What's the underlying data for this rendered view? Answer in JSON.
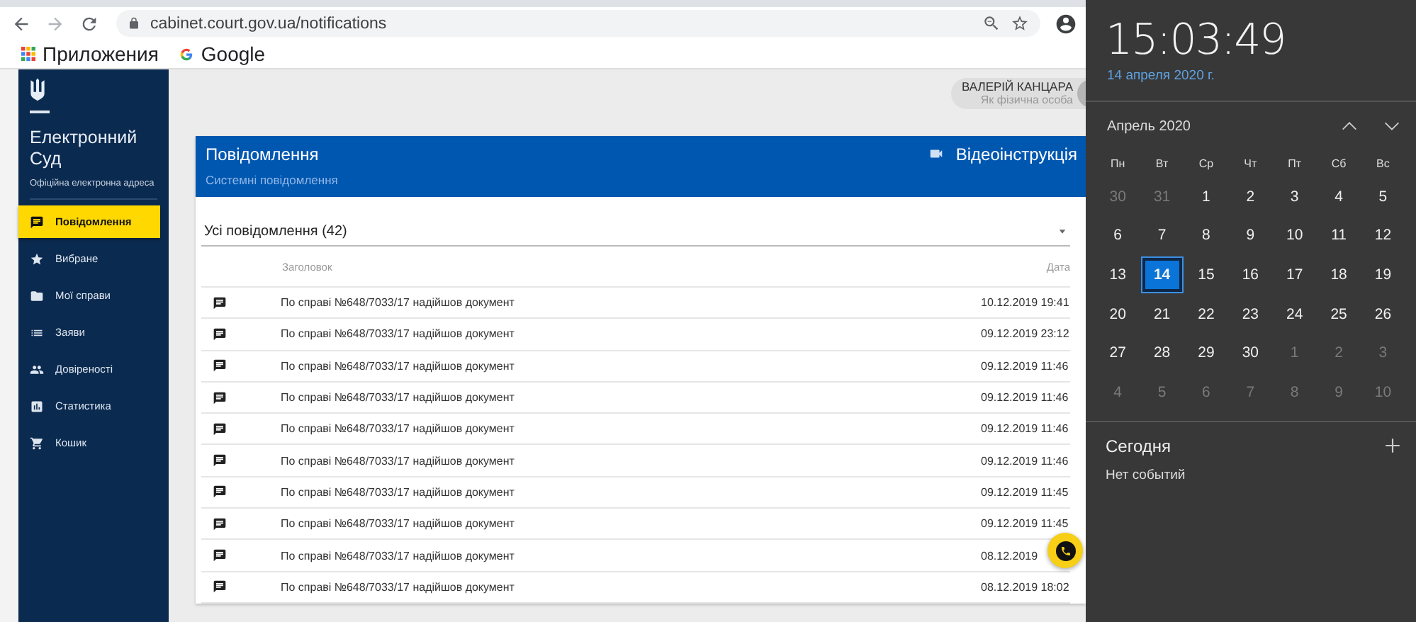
{
  "browser": {
    "url": "cabinet.court.gov.ua/notifications",
    "bookmarks": [
      {
        "label": "Приложения"
      },
      {
        "label": "Google"
      }
    ]
  },
  "sidebar": {
    "title": "Електронний Суд",
    "subtitle": "Офіційна електронна адреса",
    "items": [
      {
        "label": "Повідомлення",
        "selected": true
      },
      {
        "label": "Вибране",
        "selected": false
      },
      {
        "label": "Мої справи",
        "selected": false
      },
      {
        "label": "Заяви",
        "selected": false
      },
      {
        "label": "Довіреності",
        "selected": false
      },
      {
        "label": "Статистика",
        "selected": false
      },
      {
        "label": "Кошик",
        "selected": false
      }
    ]
  },
  "user": {
    "name": "ВАЛЕРІЙ КАНЦАРА",
    "role": "Як фізична особа"
  },
  "card": {
    "title": "Повідомлення",
    "subtitle": "Системні повідомлення",
    "video_link": "Відеоінструкція",
    "filter": "Усі повідомлення (42)",
    "table": {
      "columns": [
        "Заголовок",
        "Дата"
      ],
      "rows": [
        {
          "title": "По справі №648/7033/17 надійшов документ",
          "date": "10.12.2019 19:41"
        },
        {
          "title": "По справі №648/7033/17 надійшов документ",
          "date": "09.12.2019 23:12"
        },
        {
          "title": "По справі №648/7033/17 надійшов документ",
          "date": "09.12.2019 11:46"
        },
        {
          "title": "По справі №648/7033/17 надійшов документ",
          "date": "09.12.2019 11:46"
        },
        {
          "title": "По справі №648/7033/17 надійшов документ",
          "date": "09.12.2019 11:46"
        },
        {
          "title": "По справі №648/7033/17 надійшов документ",
          "date": "09.12.2019 11:46"
        },
        {
          "title": "По справі №648/7033/17 надійшов документ",
          "date": "09.12.2019 11:45"
        },
        {
          "title": "По справі №648/7033/17 надійшов документ",
          "date": "09.12.2019 11:45"
        },
        {
          "title": "По справі №648/7033/17 надійшов документ",
          "date": "08.12.2019"
        },
        {
          "title": "По справі №648/7033/17 надійшов документ",
          "date": "08.12.2019 18:02"
        }
      ]
    }
  },
  "calendar": {
    "time": "15:03:49",
    "date": "14 апреля 2020 г.",
    "month": "Апрель 2020",
    "weekdays": [
      "Пн",
      "Вт",
      "Ср",
      "Чт",
      "Пт",
      "Сб",
      "Вс"
    ],
    "weeks": [
      [
        {
          "day": "30",
          "in_month": false,
          "selected": false
        },
        {
          "day": "31",
          "in_month": false,
          "selected": false
        },
        {
          "day": "1",
          "in_month": true,
          "selected": false
        },
        {
          "day": "2",
          "in_month": true,
          "selected": false
        },
        {
          "day": "3",
          "in_month": true,
          "selected": false
        },
        {
          "day": "4",
          "in_month": true,
          "selected": false
        },
        {
          "day": "5",
          "in_month": true,
          "selected": false
        }
      ],
      [
        {
          "day": "6",
          "in_month": true,
          "selected": false
        },
        {
          "day": "7",
          "in_month": true,
          "selected": false
        },
        {
          "day": "8",
          "in_month": true,
          "selected": false
        },
        {
          "day": "9",
          "in_month": true,
          "selected": false
        },
        {
          "day": "10",
          "in_month": true,
          "selected": false
        },
        {
          "day": "11",
          "in_month": true,
          "selected": false
        },
        {
          "day": "12",
          "in_month": true,
          "selected": false
        }
      ],
      [
        {
          "day": "13",
          "in_month": true,
          "selected": false
        },
        {
          "day": "14",
          "in_month": true,
          "selected": true
        },
        {
          "day": "15",
          "in_month": true,
          "selected": false
        },
        {
          "day": "16",
          "in_month": true,
          "selected": false
        },
        {
          "day": "17",
          "in_month": true,
          "selected": false
        },
        {
          "day": "18",
          "in_month": true,
          "selected": false
        },
        {
          "day": "19",
          "in_month": true,
          "selected": false
        }
      ],
      [
        {
          "day": "20",
          "in_month": true,
          "selected": false
        },
        {
          "day": "21",
          "in_month": true,
          "selected": false
        },
        {
          "day": "22",
          "in_month": true,
          "selected": false
        },
        {
          "day": "23",
          "in_month": true,
          "selected": false
        },
        {
          "day": "24",
          "in_month": true,
          "selected": false
        },
        {
          "day": "25",
          "in_month": true,
          "selected": false
        },
        {
          "day": "26",
          "in_month": true,
          "selected": false
        }
      ],
      [
        {
          "day": "27",
          "in_month": true,
          "selected": false
        },
        {
          "day": "28",
          "in_month": true,
          "selected": false
        },
        {
          "day": "29",
          "in_month": true,
          "selected": false
        },
        {
          "day": "30",
          "in_month": true,
          "selected": false
        },
        {
          "day": "1",
          "in_month": false,
          "selected": false
        },
        {
          "day": "2",
          "in_month": false,
          "selected": false
        },
        {
          "day": "3",
          "in_month": false,
          "selected": false
        }
      ],
      [
        {
          "day": "4",
          "in_month": false,
          "selected": false
        },
        {
          "day": "5",
          "in_month": false,
          "selected": false
        },
        {
          "day": "6",
          "in_month": false,
          "selected": false
        },
        {
          "day": "7",
          "in_month": false,
          "selected": false
        },
        {
          "day": "8",
          "in_month": false,
          "selected": false
        },
        {
          "day": "9",
          "in_month": false,
          "selected": false
        },
        {
          "day": "10",
          "in_month": false,
          "selected": false
        }
      ]
    ],
    "today_title": "Сегодня",
    "events_text": "Нет событий"
  }
}
